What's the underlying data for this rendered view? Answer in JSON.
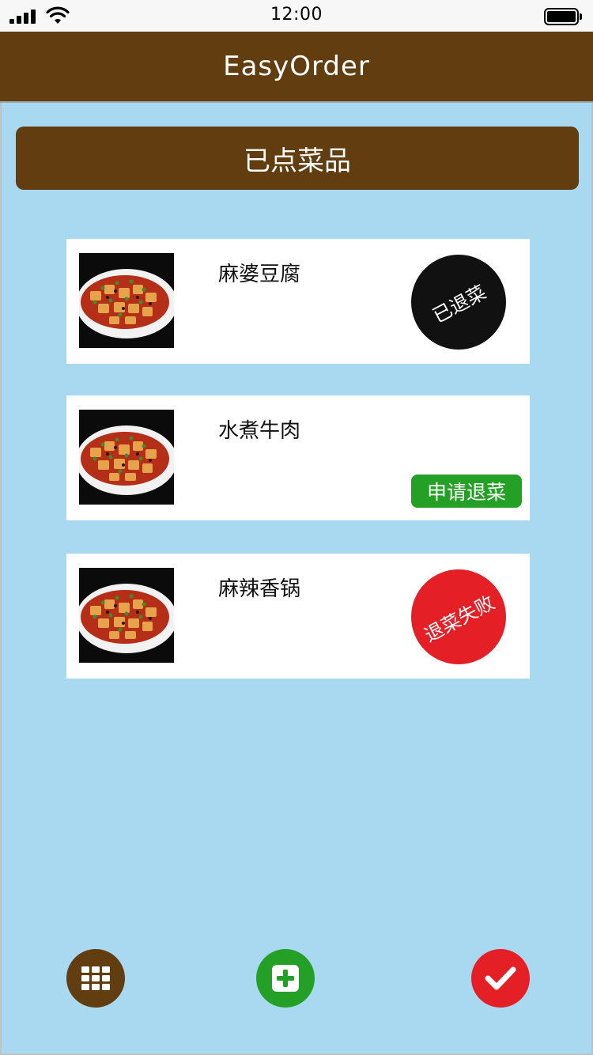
{
  "status_bar": {
    "time": "12:00"
  },
  "app": {
    "title": "EasyOrder"
  },
  "section": {
    "title": "已点菜品"
  },
  "orders": [
    {
      "name": "麻婆豆腐",
      "status": "已退菜",
      "status_style": "stamp-black"
    },
    {
      "name": "水煮牛肉",
      "status": "申请退菜",
      "status_style": "button-green"
    },
    {
      "name": "麻辣香锅",
      "status": "退菜失败",
      "status_style": "stamp-red"
    }
  ],
  "actions": {
    "menu_icon": "grid-icon",
    "add_icon": "plus-square-icon",
    "confirm_icon": "checkmark-icon"
  },
  "colors": {
    "brand_brown": "#613d10",
    "background": "#a9d8f1",
    "green": "#24a027",
    "red": "#e41f26",
    "black": "#111111"
  }
}
